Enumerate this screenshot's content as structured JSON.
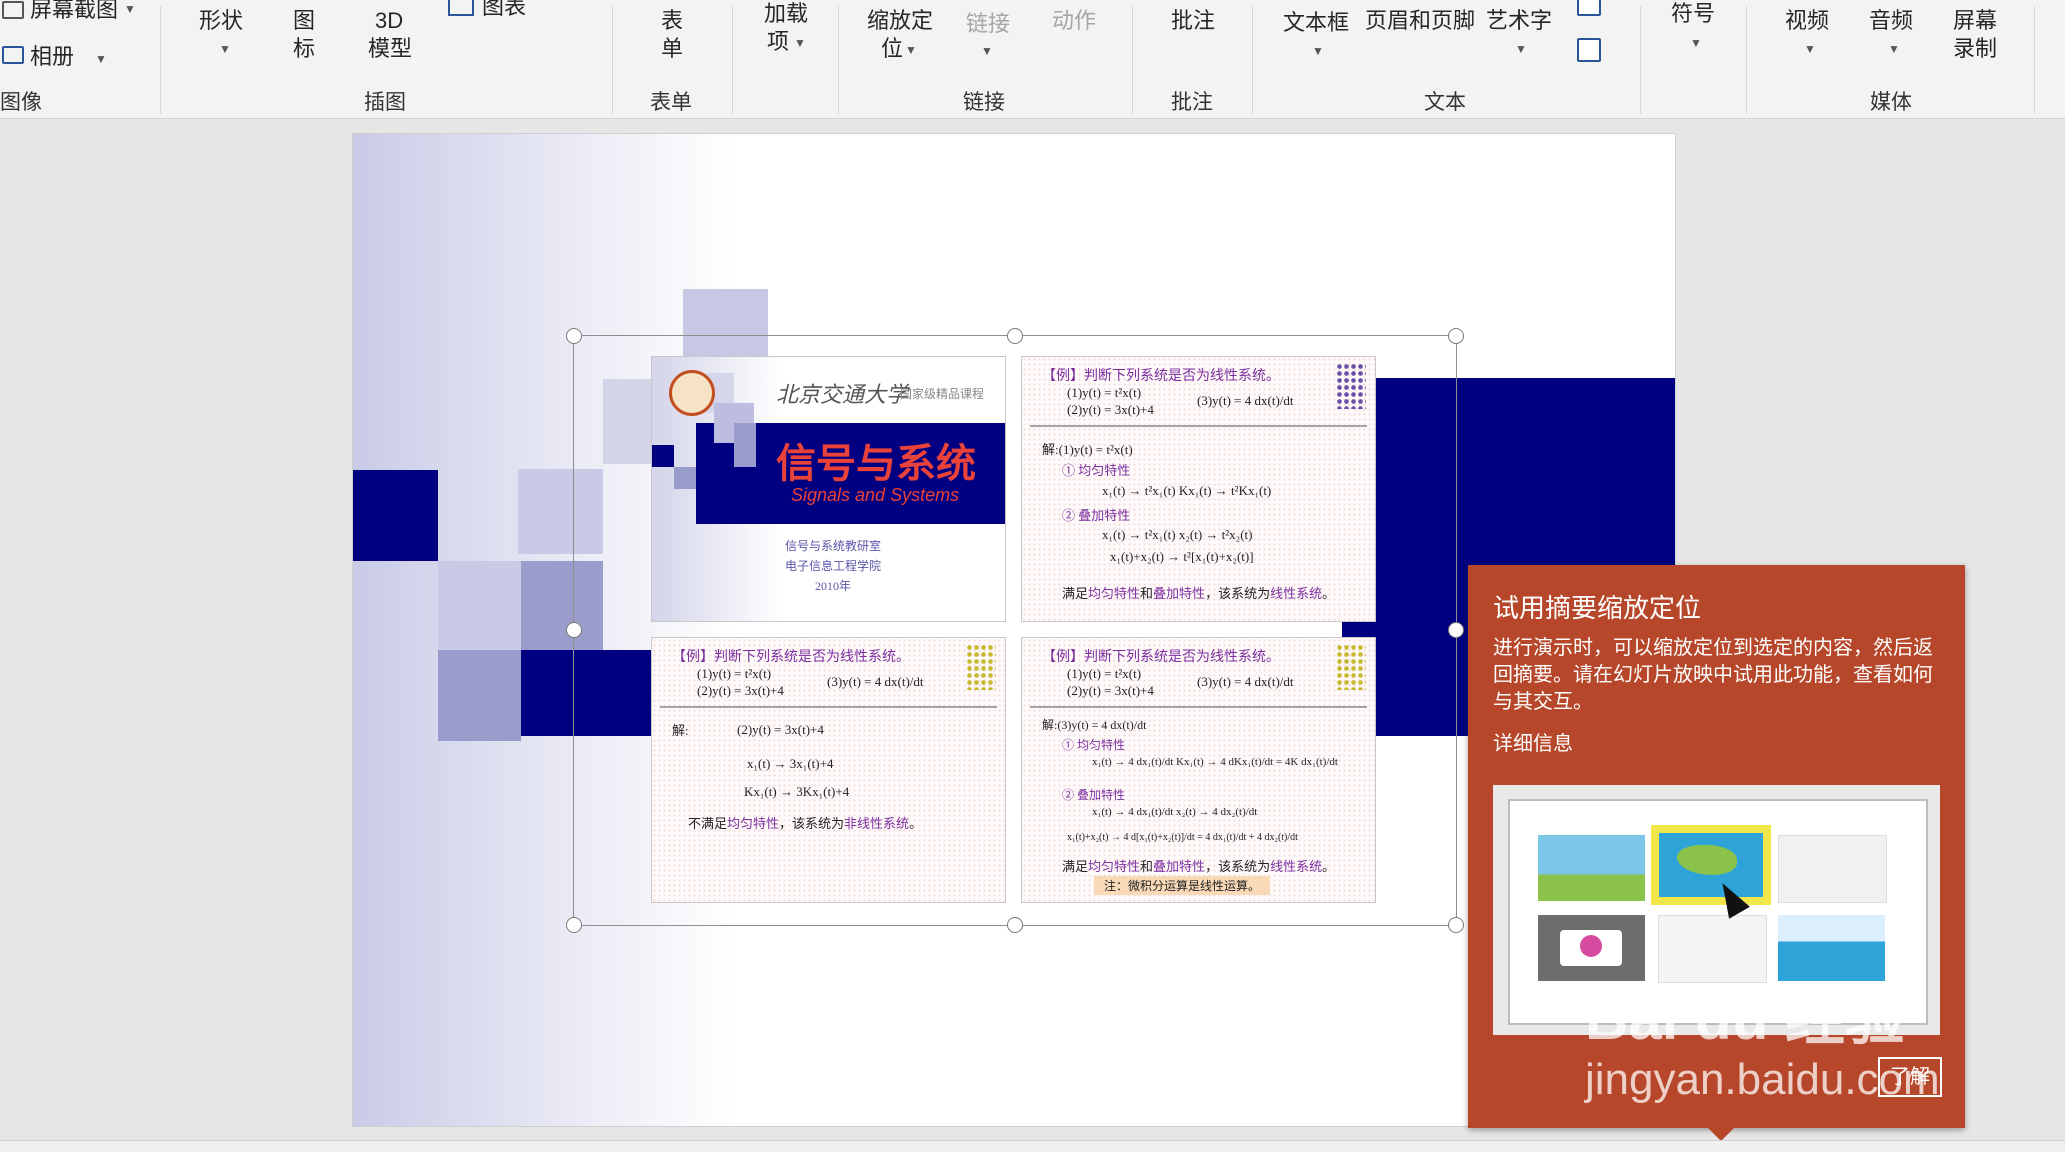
{
  "ribbon": {
    "screenshot": "屏幕截图",
    "album": "相册",
    "image_group": "图像",
    "shapes": "形状",
    "icons_1": "图",
    "icons_2": "标",
    "model_1": "3D",
    "model_2": "模型",
    "chart": "图表",
    "insert_group": "插图",
    "form_1": "表",
    "form_2": "单",
    "form_group": "表单",
    "addin_1": "加载",
    "addin_2": "项",
    "zoom_1": "缩放定",
    "zoom_2": "位",
    "link": "链接",
    "action": "动作",
    "links_group": "链接",
    "comment": "批注",
    "comment_group": "批注",
    "textbox": "文本框",
    "header_footer": "页眉和页脚",
    "wordart": "艺术字",
    "text_group": "文本",
    "symbol": "符号",
    "video": "视频",
    "audio": "音频",
    "screen_1": "屏幕",
    "screen_2": "录制",
    "media_group": "媒体"
  },
  "thumb1": {
    "univ": "北京交通大学",
    "course_tag": "国家级精品课程",
    "title_cn": "信号与系统",
    "title_en": "Signals and Systems",
    "dept": "信号与系统教研室",
    "school": "电子信息工程学院",
    "year": "2010年"
  },
  "thumb2": {
    "head": "【例】判断下列系统是否为线性系统。",
    "eq1": "(1)y(t) = t²x(t)",
    "eq2": "(2)y(t) = 3x(t)+4",
    "eq3": "(3)y(t) = 4 dx(t)/dt",
    "sol": "解:(1)y(t) = t²x(t)",
    "p1": "① 均匀特性",
    "l1": "x₁(t) → t²x₁(t)      Kx₁(t) → t²Kx₁(t)",
    "p2": "② 叠加特性",
    "l2": "x₁(t) → t²x₁(t)      x₂(t) → t²x₂(t)",
    "l3": "x₁(t)+x₂(t) → t²[x₁(t)+x₂(t)]",
    "conc_a": "满足",
    "conc_b": "均匀特性",
    "conc_c": "和",
    "conc_d": "叠加特性",
    "conc_e": "，该系统为",
    "conc_f": "线性系统",
    "conc_g": "。"
  },
  "thumb3": {
    "head": "【例】判断下列系统是否为线性系统。",
    "eq1": "(1)y(t) = t²x(t)",
    "eq2": "(2)y(t) = 3x(t)+4",
    "eq3": "(3)y(t) = 4 dx(t)/dt",
    "sol": "解:",
    "l0": "(2)y(t) = 3x(t)+4",
    "l1": "x₁(t) → 3x₁(t)+4",
    "l2": "Kx₁(t) → 3Kx₁(t)+4",
    "conc_a": "不满足",
    "conc_b": "均匀特性",
    "conc_c": "，该系统为",
    "conc_d": "非线性系统",
    "conc_e": "。"
  },
  "thumb4": {
    "head": "【例】判断下列系统是否为线性系统。",
    "eq1": "(1)y(t) = t²x(t)",
    "eq2": "(2)y(t) = 3x(t)+4",
    "eq3": "(3)y(t) = 4 dx(t)/dt",
    "sol": "解:(3)y(t) = 4 dx(t)/dt",
    "p1": "① 均匀特性",
    "l1": "x₁(t) → 4 dx₁(t)/dt    Kx₁(t) → 4 dKx₁(t)/dt = 4K dx₁(t)/dt",
    "p2": "② 叠加特性",
    "l2": "x₁(t) → 4 dx₁(t)/dt      x₂(t) → 4 dx₂(t)/dt",
    "l3": "x₁(t)+x₂(t) → 4 d[x₁(t)+x₂(t)]/dt = 4 dx₁(t)/dt + 4 dx₂(t)/dt",
    "conc_a": "满足",
    "conc_b": "均匀特性",
    "conc_c": "和",
    "conc_d": "叠加特性",
    "conc_e": "，该系统为",
    "conc_f": "线性系统",
    "conc_g": "。",
    "note": "注：微积分运算是线性运算。"
  },
  "tooltip": {
    "title": "试用摘要缩放定位",
    "body": "进行演示时，可以缩放定位到选定的内容，然后返回摘要。请在幻灯片放映中试用此功能，查看如何与其交互。",
    "link": "详细信息",
    "button": "了解"
  },
  "watermark": {
    "brand": "Bai du 经验",
    "url": "jingyan.baidu.com"
  },
  "colors": {
    "navy": "#000080",
    "tooltip_bg": "#b7472a",
    "title_red": "#e8423a",
    "purple_text": "#7b2fa0"
  }
}
